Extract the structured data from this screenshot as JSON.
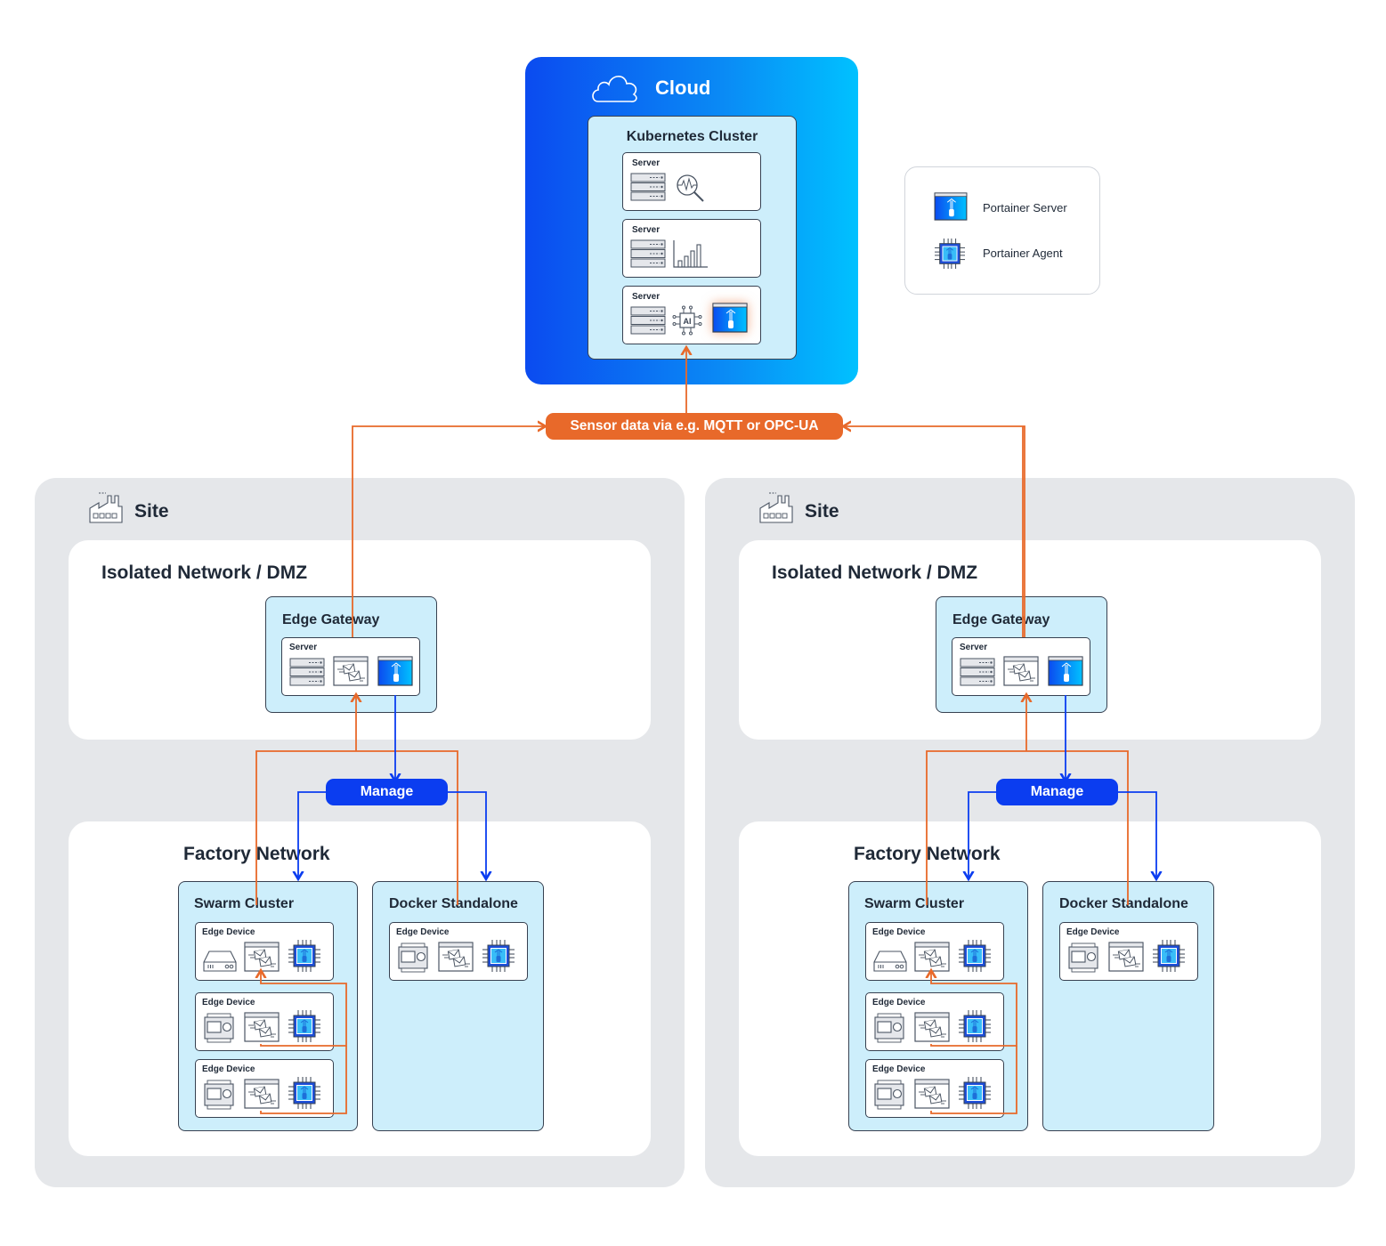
{
  "cloud": {
    "title": "Cloud",
    "icon": "cloud-icon",
    "cluster": {
      "title": "Kubernetes Cluster",
      "servers": [
        {
          "label": "Server",
          "icons": [
            "server-rack-icon",
            "monitoring-search-icon"
          ]
        },
        {
          "label": "Server",
          "icons": [
            "server-rack-icon",
            "bar-chart-icon"
          ]
        },
        {
          "label": "Server",
          "icons": [
            "server-rack-icon",
            "ai-chip-icon",
            "portainer-server-icon"
          ]
        }
      ]
    }
  },
  "legend": {
    "items": [
      {
        "label": "Portainer Server",
        "icon": "portainer-server-icon"
      },
      {
        "label": "Portainer Agent",
        "icon": "portainer-agent-icon"
      }
    ]
  },
  "sensor_label": "Sensor data via e.g. MQTT or OPC-UA",
  "colors": {
    "data_flow": "#e8692a",
    "manage_flow": "#0b3df0",
    "cluster_fill": "#cdeefb",
    "site_bg": "#e5e7ea",
    "cloud_gradient_start": "#0b4bf0",
    "cloud_gradient_end": "#00c1ff"
  },
  "sites": [
    {
      "title": "Site",
      "icon": "factory-icon",
      "dmz": {
        "title": "Isolated Network / DMZ",
        "gateway": {
          "title": "Edge Gateway",
          "server_label": "Server",
          "icons": [
            "server-rack-icon",
            "message-broker-icon",
            "portainer-server-icon"
          ]
        }
      },
      "manage_label": "Manage",
      "factory": {
        "title": "Factory Network",
        "swarm": {
          "title": "Swarm Cluster",
          "devices": [
            {
              "label": "Edge Device",
              "icons": [
                "nas-device-icon",
                "message-broker-icon",
                "portainer-agent-icon"
              ]
            },
            {
              "label": "Edge Device",
              "icons": [
                "plc-device-icon",
                "message-broker-icon",
                "portainer-agent-icon"
              ]
            },
            {
              "label": "Edge Device",
              "icons": [
                "plc-device-icon",
                "message-broker-icon",
                "portainer-agent-icon"
              ]
            }
          ]
        },
        "standalone": {
          "title": "Docker Standalone",
          "devices": [
            {
              "label": "Edge Device",
              "icons": [
                "plc-device-icon",
                "message-broker-icon",
                "portainer-agent-icon"
              ]
            }
          ]
        }
      }
    },
    {
      "title": "Site",
      "icon": "factory-icon",
      "dmz": {
        "title": "Isolated Network / DMZ",
        "gateway": {
          "title": "Edge Gateway",
          "server_label": "Server",
          "icons": [
            "server-rack-icon",
            "message-broker-icon",
            "portainer-server-icon"
          ]
        }
      },
      "manage_label": "Manage",
      "factory": {
        "title": "Factory Network",
        "swarm": {
          "title": "Swarm Cluster",
          "devices": [
            {
              "label": "Edge Device",
              "icons": [
                "nas-device-icon",
                "message-broker-icon",
                "portainer-agent-icon"
              ]
            },
            {
              "label": "Edge Device",
              "icons": [
                "plc-device-icon",
                "message-broker-icon",
                "portainer-agent-icon"
              ]
            },
            {
              "label": "Edge Device",
              "icons": [
                "plc-device-icon",
                "message-broker-icon",
                "portainer-agent-icon"
              ]
            }
          ]
        },
        "standalone": {
          "title": "Docker Standalone",
          "devices": [
            {
              "label": "Edge Device",
              "icons": [
                "plc-device-icon",
                "message-broker-icon",
                "portainer-agent-icon"
              ]
            }
          ]
        }
      }
    }
  ]
}
